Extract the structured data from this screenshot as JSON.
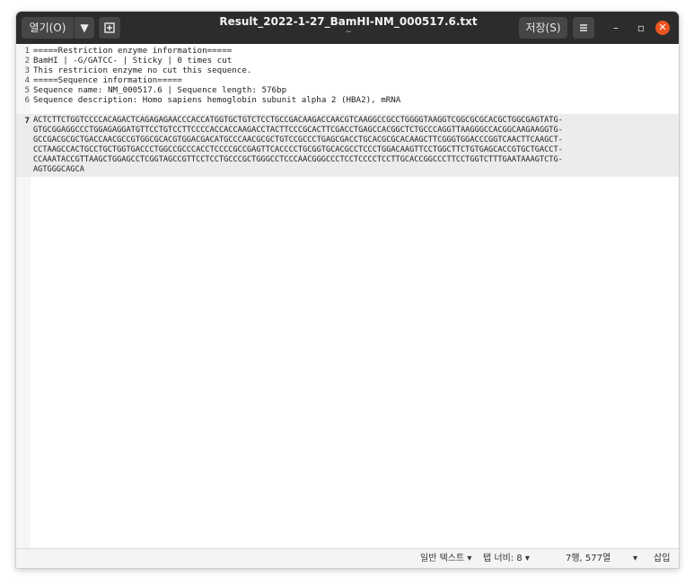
{
  "titlebar": {
    "open_label": "열기(O)",
    "title": "Result_2022-1-27_BamHI-NM_000517.6.txt",
    "subtitle": "~",
    "save_label": "저장(S)",
    "min_glyph": "–",
    "max_glyph": "▫",
    "close_glyph": "✕"
  },
  "lines": [
    {
      "num": "1",
      "text": "=====Restriction enzyme information====="
    },
    {
      "num": "2",
      "text": "BamHI | -G/GATCC- | Sticky | 0 times cut"
    },
    {
      "num": "3",
      "text": "This restricion enzyme no cut this sequence."
    },
    {
      "num": "4",
      "text": "=====Sequence information====="
    },
    {
      "num": "5",
      "text": "Sequence name: NM_000517.6 | Sequence length: 576bp"
    },
    {
      "num": "6",
      "text": "Sequence description: Homo sapiens hemoglobin subunit alpha 2 (HBA2), mRNA"
    },
    {
      "num": "7",
      "text": ""
    }
  ],
  "sequence_lines": [
    "ACTCTTCTGGTCCCCACAGACTCAGAGAGAACCCACCATGGTGCTGTCTCCTGCCGACAAGACCAACGTCAAGGCCGCCTGGGGTAAGGTCGGCGCGCACGCTGGCGAGTATG-",
    "GTGCGGAGGCCCTGGAGAGGATGTTCCTGTCCTTCCCCACCACCAAGACCTACTTCCCGCACTTCGACCTGAGCCACGGCTCTGCCCAGGTTAAGGGCCACGGCAAGAAGGTG-",
    "GCCGACGCGCTGACCAACGCCGTGGCGCACGTGGACGACATGCCCAACGCGCTGTCCGCCCTGAGCGACCTGCACGCGCACAAGCTTCGGGTGGACCCGGTCAACTTCAAGCT-",
    "CCTAAGCCACTGCCTGCTGGTGACCCTGGCCGCCCACCTCCCCGCCGAGTTCACCCCTGCGGTGCACGCCTCCCTGGACAAGTTCCTGGCTTCTGTGAGCACCGTGCTGACCT-",
    "CCAAATACCGTTAAGCTGGAGCCTCGGTAGCCGTTCCTCCTGCCCGCTGGGCCTCCCAACGGGCCCTCCTCCCCTCCTTGCACCGGCCCTTCCTGGTCTTTGAATAAAGTCTG-",
    "AGTGGGCAGCA"
  ],
  "statusbar": {
    "syntax": "일반 텍스트 ▾",
    "tab_width": "탭 너비: 8 ▾",
    "position": "7행, 577열",
    "insert_mode_dropdown": "▾",
    "insert_mode": "삽입"
  },
  "colors": {
    "titlebar_bg": "#2c2c2c",
    "close_button": "#e95420",
    "current_line_bg": "#ececec"
  }
}
